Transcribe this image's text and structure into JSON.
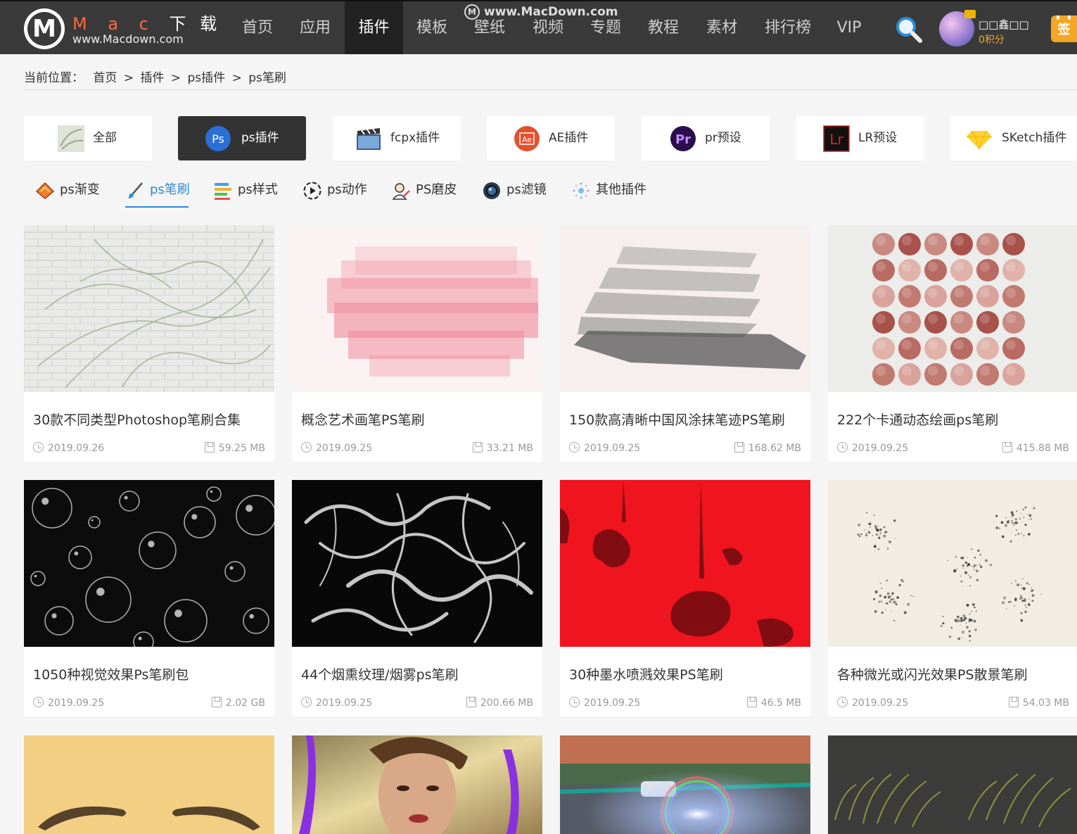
{
  "brand": {
    "title_latin": "M a c",
    "title_cn": "下 载",
    "url": "www.Macdown.com",
    "logo_letter": "M"
  },
  "watermark": {
    "icon": "M",
    "text": "www.MacDown.com"
  },
  "nav": [
    {
      "label": "首页"
    },
    {
      "label": "应用"
    },
    {
      "label": "插件"
    },
    {
      "label": "模板"
    },
    {
      "label": "壁纸"
    },
    {
      "label": "视频"
    },
    {
      "label": "专题"
    },
    {
      "label": "教程"
    },
    {
      "label": "素材"
    },
    {
      "label": "排行榜"
    },
    {
      "label": "VIP"
    }
  ],
  "nav_active_index": 2,
  "user": {
    "name": "□□鑫□□",
    "points": "0积分",
    "signin_label": "签"
  },
  "breadcrumb": {
    "prefix": "当前位置：",
    "items": [
      "首页",
      "插件",
      "ps插件",
      "ps笔刷"
    ],
    "sep": ">"
  },
  "categories": [
    {
      "label": "全部",
      "icon": "brush-sample-icon"
    },
    {
      "label": "ps插件",
      "icon": "photoshop-icon",
      "icon_text": "Ps"
    },
    {
      "label": "fcpx插件",
      "icon": "clapperboard-icon"
    },
    {
      "label": "AE插件",
      "icon": "after-effects-icon",
      "icon_text": "Ae"
    },
    {
      "label": "pr预设",
      "icon": "premiere-icon",
      "icon_text": "Pr"
    },
    {
      "label": "LR预设",
      "icon": "lightroom-icon",
      "icon_text": "Lr"
    },
    {
      "label": "SKetch插件",
      "icon": "sketch-diamond-icon"
    }
  ],
  "category_active_index": 1,
  "subtabs": [
    {
      "label": "ps渐变",
      "icon": "gradient-icon"
    },
    {
      "label": "ps笔刷",
      "icon": "brush-icon"
    },
    {
      "label": "ps样式",
      "icon": "style-icon"
    },
    {
      "label": "ps动作",
      "icon": "action-play-icon"
    },
    {
      "label": "PS磨皮",
      "icon": "skin-smoothing-icon"
    },
    {
      "label": "ps滤镜",
      "icon": "filter-lens-icon"
    },
    {
      "label": "其他插件",
      "icon": "sparkle-icon"
    }
  ],
  "subtab_active_index": 1,
  "cards": [
    {
      "title": "30款不同类型Photoshop笔刷合集",
      "date": "2019.09.26",
      "size": "59.25 MB"
    },
    {
      "title": "概念艺术画笔PS笔刷",
      "date": "2019.09.25",
      "size": "33.21 MB"
    },
    {
      "title": "150款高清晰中国风涂抹笔迹PS笔刷",
      "date": "2019.09.25",
      "size": "168.62 MB"
    },
    {
      "title": "222个卡通动态绘画ps笔刷",
      "date": "2019.09.25",
      "size": "415.88 MB"
    },
    {
      "title": "1050种视觉效果Ps笔刷包",
      "date": "2019.09.25",
      "size": "2.02 GB"
    },
    {
      "title": "44个烟熏纹理/烟雾ps笔刷",
      "date": "2019.09.25",
      "size": "200.66 MB"
    },
    {
      "title": "30种墨水喷溅效果PS笔刷",
      "date": "2019.09.25",
      "size": "46.5 MB"
    },
    {
      "title": "各种微光或闪光效果PS散景笔刷",
      "date": "2019.09.25",
      "size": "54.03 MB"
    },
    {
      "title": "",
      "date": "",
      "size": ""
    },
    {
      "title": "",
      "date": "",
      "size": ""
    },
    {
      "title": "",
      "date": "",
      "size": ""
    },
    {
      "title": "",
      "date": "",
      "size": ""
    }
  ],
  "colors": {
    "header_bg": "#3a3a3a",
    "active_nav_bg": "#222222",
    "accent_blue": "#2d8ad8",
    "brand_orange": "#ff6a3c",
    "points_orange": "#f5a623"
  }
}
